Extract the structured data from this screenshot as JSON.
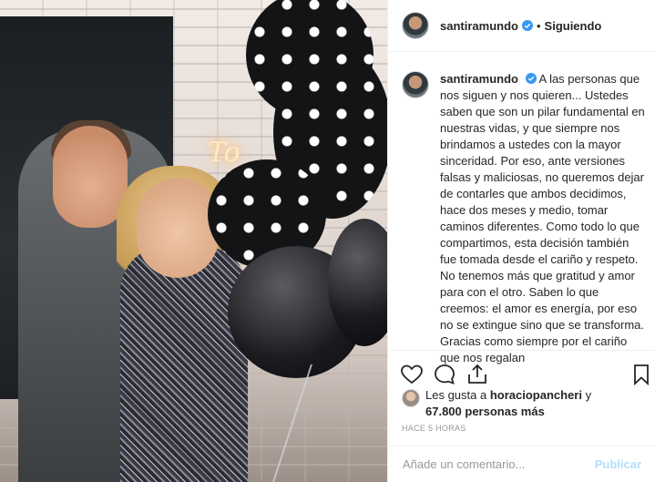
{
  "header": {
    "username": "santiramundo",
    "separator": "•",
    "follow_status": "Siguiendo"
  },
  "caption": {
    "username": "santiramundo",
    "text": "A las personas que nos siguen y nos quieren... Ustedes saben que son un pilar fundamental en nuestras vidas, y que siempre nos brindamos a ustedes con la mayor sinceridad. Por eso, ante versiones falsas y maliciosas, no queremos dejar de contarles que ambos decidimos, hace dos meses y medio, tomar caminos diferentes. Como todo lo que compartimos, esta decisión también fue tomada desde el cariño y respeto. No tenemos más que gratitud y amor para con el otro. Saben lo que creemos: el amor es energía, por eso no se extingue sino que se transforma. Gracias como siempre por el cariño que nos regalan"
  },
  "likes": {
    "prefix": "Les gusta a ",
    "user": "horaciopancheri",
    "joiner": " y",
    "count": "67.800 personas más"
  },
  "timestamp": "HACE 5 HORAS",
  "comment": {
    "placeholder": "Añade un comentario...",
    "publish_label": "Publicar"
  },
  "photo": {
    "neon_sign": "To"
  },
  "icons": {
    "like": "heart-icon",
    "comment": "comment-icon",
    "share": "share-icon",
    "save": "bookmark-icon",
    "verified": "verified-badge-icon"
  },
  "colors": {
    "verified": "#3897f0",
    "publish_disabled": "#b2dffc",
    "text": "#262626",
    "muted": "#999999",
    "border": "#efefef"
  }
}
